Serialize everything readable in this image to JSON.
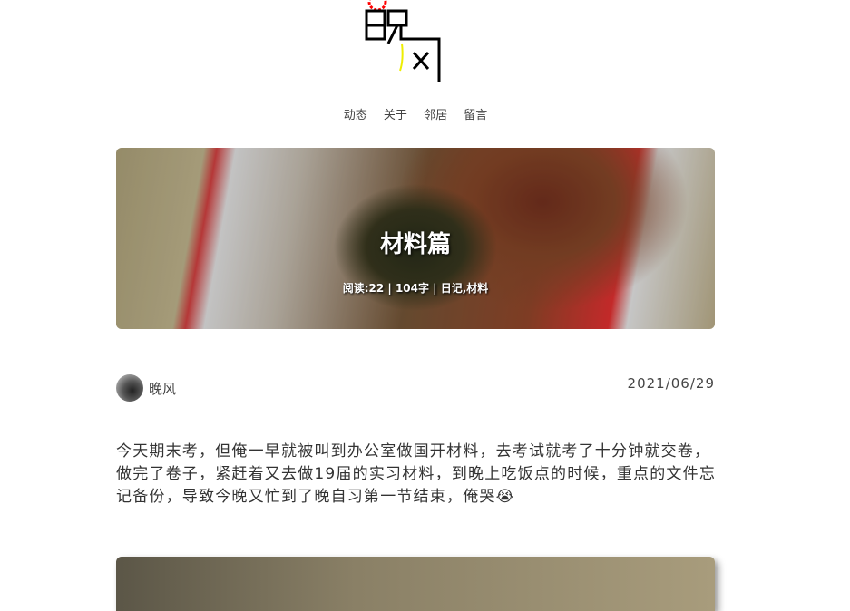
{
  "site": {
    "logo_text": "晚风"
  },
  "nav": {
    "items": [
      {
        "label": "动态"
      },
      {
        "label": "关于"
      },
      {
        "label": "邻居"
      },
      {
        "label": "留言"
      }
    ]
  },
  "post": {
    "title": "材料篇",
    "meta": "阅读:22 | 104字 | 日记,材料",
    "author": "晚风",
    "date": "2021/06/29",
    "content": "今天期末考，但俺一早就被叫到办公室做国开材料，去考试就考了十分钟就交卷，做完了卷子，紧赶着又去做19届的实习材料，到晚上吃饭点的时候，重点的文件忘记备份，导致今晚又忙到了晚自习第一节结束，俺哭😭"
  }
}
